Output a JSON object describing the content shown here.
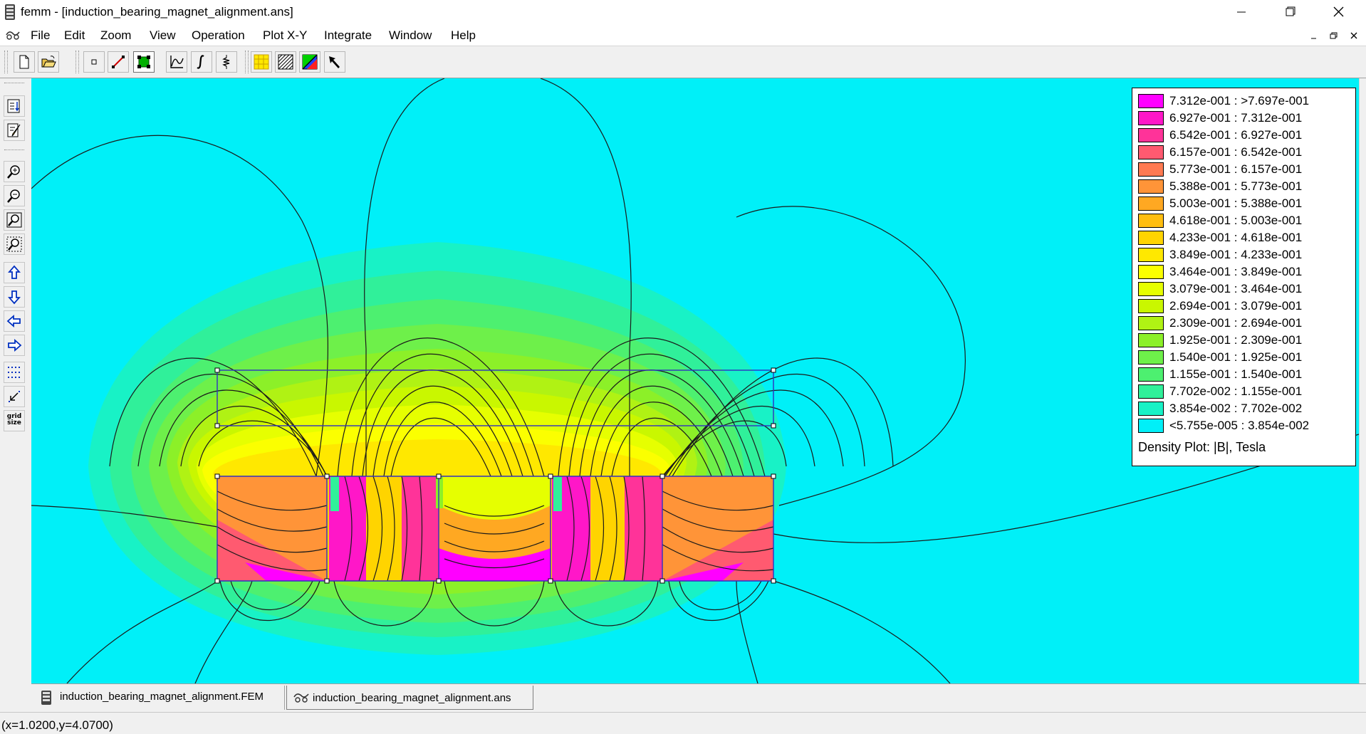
{
  "window": {
    "title": "femm - [induction_bearing_magnet_alignment.ans]"
  },
  "menu": {
    "items": [
      "File",
      "Edit",
      "Zoom",
      "View",
      "Operation",
      "Plot X-Y",
      "Integrate",
      "Window",
      "Help"
    ]
  },
  "toolbar": {
    "icons": [
      "new-file-icon",
      "open-folder-icon",
      "point-icon",
      "line-icon",
      "block-icon",
      "plot-xy-icon",
      "integrate-icon",
      "circuit-icon",
      "contour-plot-icon",
      "density-plot-icon",
      "vector-plot-icon",
      "arrow-pointer-icon"
    ]
  },
  "left_toolbar": {
    "grid_size_label": "grid size"
  },
  "legend": {
    "entries": [
      {
        "label": "7.312e-001 : >7.697e-001",
        "color": "#ff00ff"
      },
      {
        "label": "6.927e-001 : 7.312e-001",
        "color": "#ff17c8"
      },
      {
        "label": "6.542e-001 : 6.927e-001",
        "color": "#ff3399"
      },
      {
        "label": "6.157e-001 : 6.542e-001",
        "color": "#ff5a70"
      },
      {
        "label": "5.773e-001 : 6.157e-001",
        "color": "#ff7a52"
      },
      {
        "label": "5.388e-001 : 5.773e-001",
        "color": "#ff9438"
      },
      {
        "label": "5.003e-001 : 5.388e-001",
        "color": "#ffa822"
      },
      {
        "label": "4.618e-001 : 5.003e-001",
        "color": "#ffbe10"
      },
      {
        "label": "4.233e-001 : 4.618e-001",
        "color": "#ffd400"
      },
      {
        "label": "3.849e-001 : 4.233e-001",
        "color": "#ffe800"
      },
      {
        "label": "3.464e-001 : 3.849e-001",
        "color": "#fbff00"
      },
      {
        "label": "3.079e-001 : 3.464e-001",
        "color": "#e6ff00"
      },
      {
        "label": "2.694e-001 : 3.079e-001",
        "color": "#c9f700"
      },
      {
        "label": "2.309e-001 : 2.694e-001",
        "color": "#b0f214"
      },
      {
        "label": "1.925e-001 : 2.309e-001",
        "color": "#8cf028"
      },
      {
        "label": "1.540e-001 : 1.925e-001",
        "color": "#6ef04a"
      },
      {
        "label": "1.155e-001 : 1.540e-001",
        "color": "#4df070"
      },
      {
        "label": "7.702e-002 : 1.155e-001",
        "color": "#30f09a"
      },
      {
        "label": "3.854e-002 : 7.702e-002",
        "color": "#18f2c6"
      },
      {
        "label": "<5.755e-005 : 3.854e-002",
        "color": "#00f0f8"
      }
    ],
    "title": "Density Plot: |B|, Tesla"
  },
  "tabs": [
    {
      "label": "induction_bearing_magnet_alignment.FEM",
      "icon": "femm-doc-icon"
    },
    {
      "label": "induction_bearing_magnet_alignment.ans",
      "icon": "postprocessor-icon"
    }
  ],
  "status": {
    "text": "(x=1.0200,y=4.0700)"
  }
}
